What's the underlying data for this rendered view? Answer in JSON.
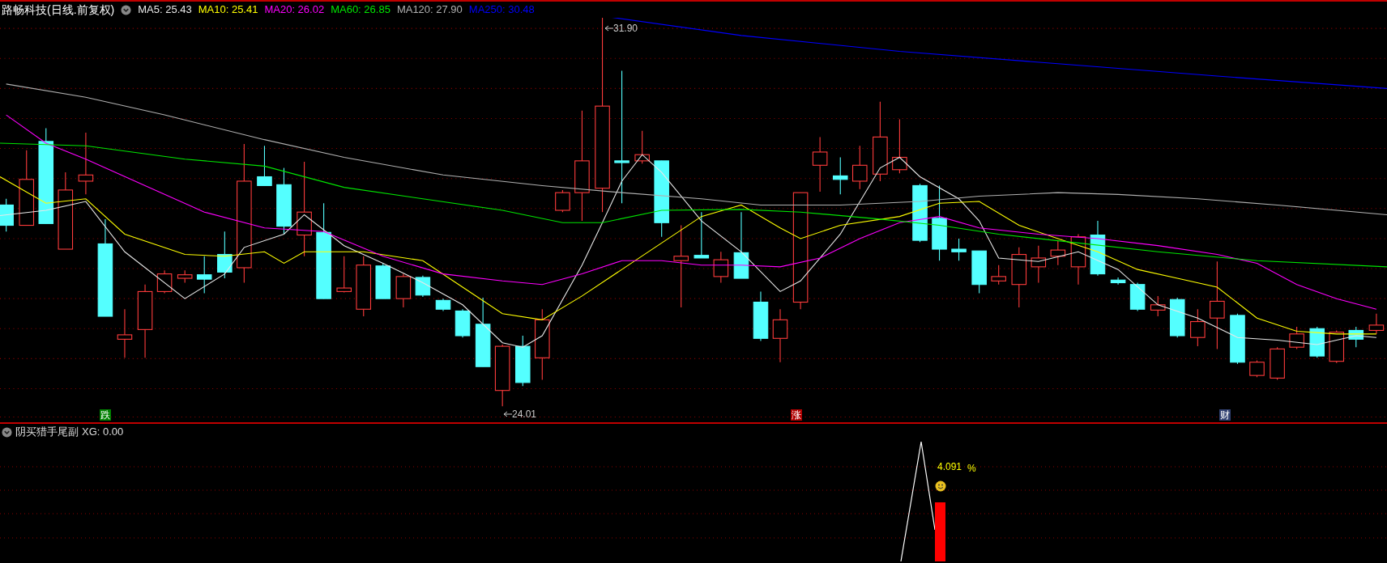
{
  "stock_title": "路畅科技(日线.前复权)",
  "ma_legend": [
    {
      "label": "MA5: 25.43",
      "color": "#e8e8e8"
    },
    {
      "label": "MA10: 25.41",
      "color": "#ffff00"
    },
    {
      "label": "MA20: 26.02",
      "color": "#ff00ff"
    },
    {
      "label": "MA60: 26.85",
      "color": "#00e600"
    },
    {
      "label": "MA120: 27.90",
      "color": "#b0b0b0"
    },
    {
      "label": "MA250: 30.48",
      "color": "#0000ff"
    }
  ],
  "price_labels": [
    {
      "kind": "high",
      "text": "31.90"
    },
    {
      "kind": "low",
      "text": "24.01"
    }
  ],
  "event_markers": [
    {
      "text": "跌",
      "color": "#008000"
    },
    {
      "text": "涨",
      "color": "#b00000"
    },
    {
      "text": "财",
      "color": "#304070"
    }
  ],
  "indicator": {
    "title": "阴买猎手尾副",
    "reading": "XG: 0.00",
    "signal_value": "4.091",
    "signal_unit": "%"
  }
}
